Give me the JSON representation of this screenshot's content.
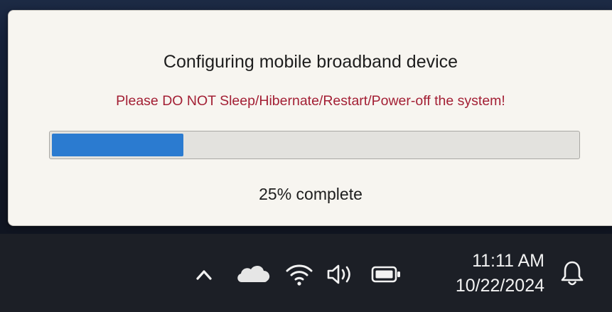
{
  "dialog": {
    "title": "Configuring mobile broadband device",
    "warning": "Please DO NOT Sleep/Hibernate/Restart/Power-off the system!",
    "progress_percent": 25,
    "progress_label": "25% complete"
  },
  "taskbar": {
    "tray_icons": [
      "chevron-up-icon",
      "onedrive-cloud-icon",
      "wifi-icon",
      "volume-icon",
      "battery-icon"
    ],
    "time": "11:11 AM",
    "date": "10/22/2024",
    "notification_icon": "bell-icon"
  },
  "colors": {
    "warning_text": "#a31f34",
    "progress_fill": "#2b7bd0",
    "dialog_background": "#f7f5f0",
    "taskbar_background": "#1c1f26"
  }
}
